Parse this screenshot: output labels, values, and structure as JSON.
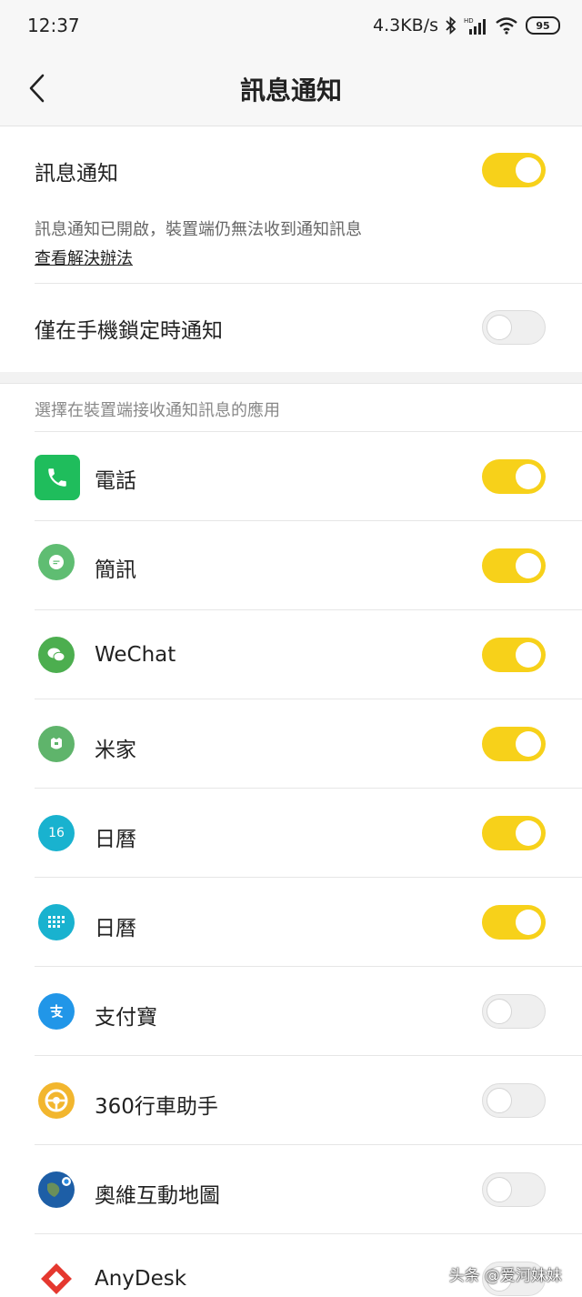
{
  "status_bar": {
    "time": "12:37",
    "network_speed": "4.3KB/s",
    "battery": "95",
    "icons": [
      "bluetooth-icon",
      "hd-signal-icon",
      "wifi-icon",
      "battery-icon"
    ]
  },
  "header": {
    "title": "訊息通知",
    "back_icon": "chevron-left-icon"
  },
  "settings": {
    "notification": {
      "label": "訊息通知",
      "enabled": true
    },
    "description": "訊息通知已開啟，裝置端仍無法收到通知訊息",
    "solution_link": "查看解決辦法",
    "lock_only": {
      "label": "僅在手機鎖定時通知",
      "enabled": false
    }
  },
  "apps_section": {
    "label": "選擇在裝置端接收通知訊息的應用",
    "apps": [
      {
        "name": "電話",
        "enabled": true,
        "icon": "phone-icon",
        "color": "#1fbd5c"
      },
      {
        "name": "簡訊",
        "enabled": true,
        "icon": "message-icon",
        "color": "#5fbd72"
      },
      {
        "name": "WeChat",
        "enabled": true,
        "icon": "wechat-icon",
        "color": "#4cae4f"
      },
      {
        "name": "米家",
        "enabled": true,
        "icon": "mijia-icon",
        "color": "#5fb46b"
      },
      {
        "name": "日曆",
        "enabled": true,
        "icon": "calendar-icon",
        "color": "#19b2cf",
        "badge": "16"
      },
      {
        "name": "日曆",
        "enabled": true,
        "icon": "calendar-grid-icon",
        "color": "#19b2cf"
      },
      {
        "name": "支付寶",
        "enabled": false,
        "icon": "alipay-icon",
        "color": "#2196e8"
      },
      {
        "name": "360行車助手",
        "enabled": false,
        "icon": "steering-wheel-icon",
        "color": "#f2b62e"
      },
      {
        "name": "奧維互動地圖",
        "enabled": false,
        "icon": "globe-icon",
        "color": "#1d5ea6"
      },
      {
        "name": "AnyDesk",
        "enabled": false,
        "icon": "anydesk-icon",
        "color": "#e5382f"
      }
    ]
  },
  "watermark": "头条 @爱河妹妹"
}
